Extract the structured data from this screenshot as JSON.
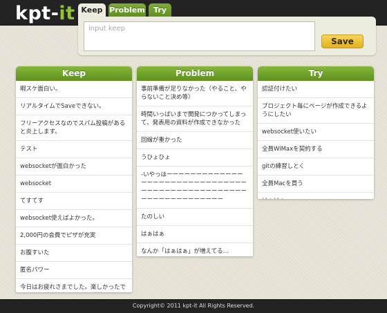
{
  "app": {
    "logo_main": "kpt-",
    "logo_accent": "it"
  },
  "tabs": [
    {
      "label": "Keep",
      "active": true
    },
    {
      "label": "Problem",
      "active": false
    },
    {
      "label": "Try",
      "active": false
    }
  ],
  "input": {
    "placeholder": "input keep",
    "value": "",
    "save_label": "Save"
  },
  "columns": {
    "keep": {
      "title": "Keep",
      "items": [
        "暇スケ面白い。",
        "リアルタイムでSaveできない。",
        "フリーアクセスなのでスパム投稿があると炎上します。",
        "テスト",
        "websocketが面白かった",
        "websocket",
        "てすてす",
        "websocket使えばよかった。",
        "2,000円の会費でピザが充実",
        "お腹すいた",
        "匿名パワー",
        "今日はお疲れさまでした。楽しかったです。 gitの勉強がてらkpt-itも触っていきますね。 @nishimuu"
      ]
    },
    "problem": {
      "title": "Problem",
      "items": [
        "事前準備が足りなかった（やること、やらないこと決め等）",
        "時間いっぱいまで開発につかってしまって、発表用の資料が作成できなかった",
        "回線が重かった",
        "うひょひょ",
        "-いやっほーーーーーーーーーーーーーーーーーーーーーーーーーーーーーーーーーーーーーーーーーーーーーーーーーーーーーーーーーーーーーーー",
        "たのしい",
        "はぁはぁ",
        "なんか「はぁはぁ」が増えてる…"
      ]
    },
    "try": {
      "title": "Try",
      "items": [
        "認証付けたい",
        "プロジェクト毎にページが作成できるようにしたい",
        "websocket使いたい",
        "全員WiMaxを契約する",
        "gitの練習しとく",
        "全員Macを買う",
        "はぁはぁ"
      ]
    }
  },
  "footer": {
    "text": "Copyright© 2011 kpt-it All Rights Reserved."
  },
  "colors": {
    "accent_green": "#7fae36",
    "topbar": "#232323",
    "save_button": "#e3b21d",
    "background": "#e8e4d8"
  }
}
